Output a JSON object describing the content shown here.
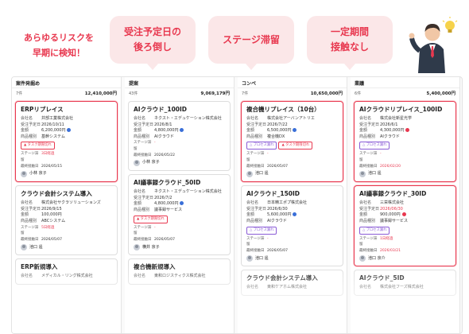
{
  "headline": {
    "line1": "あらゆるリスクを",
    "line2": "早期に検知！"
  },
  "bubbles": [
    {
      "line1": "受注予定日の",
      "line2": "後ろ倒し"
    },
    {
      "line1": "ステージ滞留",
      "line2": ""
    },
    {
      "line1": "一定期間",
      "line2": "接触なし"
    }
  ],
  "labels": {
    "company": "会社名",
    "order_date": "受注予定日",
    "amount": "金額",
    "product": "商品種別",
    "stage_stay": "ステージ滞留",
    "last_contact": "最終接触日"
  },
  "columns": [
    {
      "name": "案件発掘め",
      "count": "7件",
      "total": "12,410,000円",
      "cards": [
        {
          "title": "ERPリプレイス",
          "company": "井部工業株式会社",
          "date": "2026/10/11",
          "amount": "6,200,000円",
          "amount_dot": "blue",
          "product": "基幹システム",
          "badges": [
            {
              "text": "▲ タスク期限切れ",
              "style": "red"
            }
          ],
          "stay": "3日経過",
          "contact": "2026/05/15",
          "owner": "小林 京子",
          "alert": true
        },
        {
          "title": "クラウド会計システム導入",
          "company": "株式会社サクラソリューションズ",
          "date": "2026/9/15",
          "amount": "100,000円",
          "amount_dot": "",
          "product": "ABCシステム",
          "badges": [],
          "stay": "5日経過",
          "contact": "2026/05/07",
          "owner": "池口 遥",
          "alert": false
        },
        {
          "title": "ERP新規導入",
          "company": "メディカル・リング株式会社",
          "date": "",
          "amount": "",
          "amount_dot": "",
          "product": "",
          "badges": [],
          "stay": "",
          "contact": "",
          "owner": "",
          "alert": false
        }
      ]
    },
    {
      "name": "提案",
      "count": "43件",
      "total": "9,069,179円",
      "cards": [
        {
          "title": "AIクラウド_100ID",
          "company": "ネクスト・エデュケーション株式会社",
          "date": "2026/8/1",
          "amount": "4,800,000円",
          "amount_dot": "blue",
          "product": "AIクラウド",
          "badges": [],
          "stay": "-",
          "contact": "2026/05/22",
          "owner": "小林 京子",
          "alert": false
        },
        {
          "title": "AI議事録クラウド_50ID",
          "company": "ネクスト・エデュケーション株式会社",
          "date": "2026/7/2",
          "amount": "4,800,000円",
          "amount_dot": "blue",
          "product": "議事録サービス",
          "badges": [
            {
              "text": "▲ タスク期限切れ",
              "style": "red"
            }
          ],
          "stay": "-",
          "contact": "2026/05/07",
          "owner": "横井 京子",
          "alert": false
        },
        {
          "title": "複合機新規導入",
          "company": "東和ロジスティクス株式会社",
          "date": "",
          "amount": "",
          "amount_dot": "",
          "product": "",
          "badges": [],
          "stay": "",
          "contact": "",
          "owner": "",
          "alert": false
        }
      ]
    },
    {
      "name": "コンペ",
      "count": "7件",
      "total": "10,650,000円",
      "cards": [
        {
          "title": "複合機リプレイス（10台）",
          "company": "株式会社アーバンアトリエ",
          "date": "2026/7/22",
          "amount": "6,500,000円",
          "amount_dot": "blue",
          "product": "複合機DX",
          "badges": [
            {
              "text": "△ プロセス漏れ",
              "style": "purple"
            },
            {
              "text": "▲ タスク期限切れ",
              "style": "red"
            }
          ],
          "stay": "-",
          "contact": "2026/05/07",
          "owner": "池口 遥",
          "alert": true
        },
        {
          "title": "AIクラウド_150ID",
          "company": "日本精工ポプ株式会社",
          "date": "2026/6/30",
          "amount": "5,600,000円",
          "amount_dot": "blue",
          "product": "AIクラウド",
          "badges": [
            {
              "text": "△ プロセス漏れ",
              "style": "purple"
            }
          ],
          "stay": "-",
          "contact": "2026/05/07",
          "owner": "池口 遥",
          "alert": false
        },
        {
          "title": "クラウド会計システム導入",
          "company": "東和ケアホム株式会社",
          "date": "",
          "amount": "",
          "amount_dot": "",
          "product": "",
          "badges": [],
          "stay": "",
          "contact": "",
          "owner": "",
          "alert": false
        }
      ]
    },
    {
      "name": "業議",
      "count": "6件",
      "total": "5,400,000円",
      "cards": [
        {
          "title": "AIクラウドリプレイス_100ID",
          "company": "株式会社新星光学",
          "date": "2026/6/1",
          "amount": "4,300,000円",
          "amount_dot": "red",
          "product": "AIクラウド",
          "badges": [
            {
              "text": "△ プロセス漏れ",
              "style": "purple"
            }
          ],
          "stay": "-",
          "contact": "2026/02/20",
          "owner": "池口 遥",
          "alert": true
        },
        {
          "title": "AI議事録クラウド_30ID",
          "company": "三栄株式会社",
          "date": "2026/06/30",
          "amount": "900,000円",
          "amount_dot": "red",
          "product": "議事録サービス",
          "badges": [
            {
              "text": "△ プロセス漏れ",
              "style": "purple"
            }
          ],
          "stay": "1日経過",
          "contact": "2026/03/21",
          "owner": "池口 京介",
          "alert": true
        },
        {
          "title": "AIクラウド_5ID",
          "company": "株式会社フーズ株式会社",
          "date": "",
          "amount": "",
          "amount_dot": "",
          "product": "",
          "badges": [],
          "stay": "",
          "contact": "",
          "owner": "",
          "alert": false
        }
      ]
    }
  ],
  "colors": {
    "accent": "#e8384f",
    "bubble_bg": "#fbe7e8",
    "purple": "#8a5bd6",
    "blue": "#3a6fd8"
  }
}
